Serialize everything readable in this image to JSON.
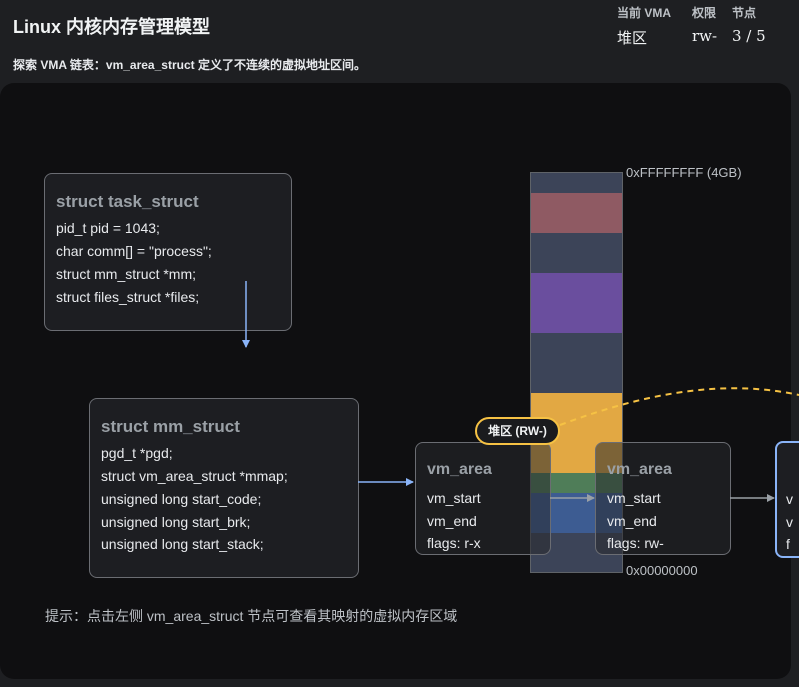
{
  "header": {
    "title": "Linux 内核内存管理模型",
    "subtitle": "探索 VMA 链表：vm_area_struct 定义了不连续的虚拟地址区间。",
    "stats": {
      "labels": [
        "当前 VMA",
        "权限",
        "节点"
      ],
      "current_vma": "堆区",
      "permission": "rw-",
      "node": "3 / 5"
    }
  },
  "task_struct": {
    "header": "struct task_struct",
    "lines": [
      "pid_t pid = 1043;",
      "char comm[] = \"process\";",
      "struct mm_struct *mm;",
      "struct files_struct *files;"
    ]
  },
  "mm_struct": {
    "header": "struct mm_struct",
    "lines": [
      "pgd_t *pgd;",
      "struct vm_area_struct *mmap;",
      "unsigned long start_code;",
      "unsigned long start_brk;",
      "unsigned long start_stack;"
    ]
  },
  "vma_nodes": [
    {
      "header": "vm_area",
      "lines": [
        "vm_start",
        "vm_end",
        "flags: r-x"
      ]
    },
    {
      "header": "vm_area",
      "lines": [
        "vm_start",
        "vm_end",
        "flags: rw-"
      ]
    }
  ],
  "vma_partial": {
    "lines": [
      "v",
      "v",
      "f"
    ]
  },
  "memory_map": {
    "top_address": "0xFFFFFFFF (4GB)",
    "bottom_address": "0x00000000",
    "segment_colors": [
      "#3c4458",
      "#8f5a63",
      "#3c4458",
      "#6a4e9e",
      "#3c4458",
      "#e2a843",
      "#4f7d58",
      "#3d5c92",
      "#3c4458"
    ],
    "highlight_label": "堆区 (RW-)"
  },
  "colors": {
    "accent": "#8ab4f8",
    "heap": "#f6c244",
    "panel": "#0f0f11"
  },
  "hint": "提示：点击左侧 vm_area_struct 节点可查看其映射的虚拟内存区域"
}
